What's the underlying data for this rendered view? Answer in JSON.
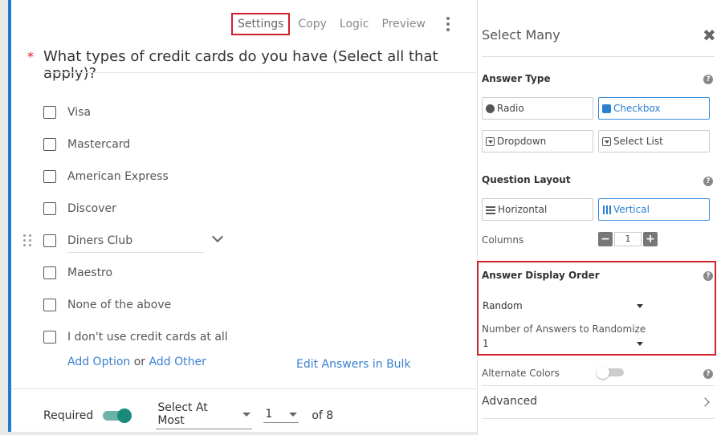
{
  "toolbar": {
    "settings": "Settings",
    "copy": "Copy",
    "logic": "Logic",
    "preview": "Preview"
  },
  "question": {
    "required_mark": "*",
    "title": "What types of credit cards do you have (Select all that apply)?",
    "options": [
      "Visa",
      "Mastercard",
      "American Express",
      "Discover",
      "Diners Club",
      "Maestro",
      "None of the above",
      "I don't use credit cards at all"
    ],
    "add_option": "Add Option",
    "or": "or",
    "add_other": "Add Other",
    "edit_bulk": "Edit Answers in Bulk"
  },
  "footer": {
    "required_label": "Required",
    "required_on": true,
    "select_mode": "Select At Most",
    "select_count": "1",
    "of_total": "of 8"
  },
  "panel": {
    "title": "Select Many",
    "answer_type_label": "Answer Type",
    "answer_types": {
      "radio": "Radio",
      "checkbox": "Checkbox",
      "dropdown": "Dropdown",
      "select_list": "Select List"
    },
    "question_layout_label": "Question Layout",
    "layouts": {
      "horizontal": "Horizontal",
      "vertical": "Vertical"
    },
    "columns_label": "Columns",
    "columns_value": "1",
    "display_order_label": "Answer Display Order",
    "display_order_value": "Random",
    "randomize_label": "Number of Answers to Randomize",
    "randomize_value": "1",
    "alternate_colors_label": "Alternate Colors",
    "advanced_label": "Advanced"
  },
  "colors": {
    "accent": "#1f7bd6",
    "highlight": "#d0202a",
    "toggle_on": "#1a8a7a"
  }
}
